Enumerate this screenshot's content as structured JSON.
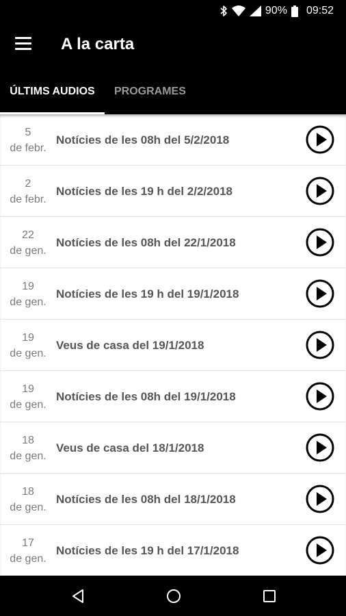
{
  "status_bar": {
    "battery": "90%",
    "time": "09:52"
  },
  "app_bar": {
    "title": "A la carta"
  },
  "tabs": [
    {
      "label": "ÚLTIMS AUDIOS",
      "active": true
    },
    {
      "label": "PROGRAMES",
      "active": false
    }
  ],
  "episodes": [
    {
      "day": "5",
      "month": "de febr.",
      "title": "Notícies de les 08h del 5/2/2018"
    },
    {
      "day": "2",
      "month": "de febr.",
      "title": "Notícies de les 19 h del 2/2/2018"
    },
    {
      "day": "22",
      "month": "de gen.",
      "title": "Notícies de les 08h del 22/1/2018"
    },
    {
      "day": "19",
      "month": "de gen.",
      "title": "Notícies de les 19 h del 19/1/2018"
    },
    {
      "day": "19",
      "month": "de gen.",
      "title": "Veus de casa del 19/1/2018"
    },
    {
      "day": "19",
      "month": "de gen.",
      "title": "Notícies de les 08h del 19/1/2018"
    },
    {
      "day": "18",
      "month": "de gen.",
      "title": "Veus de casa del 18/1/2018"
    },
    {
      "day": "18",
      "month": "de gen.",
      "title": "Notícies de les 08h del 18/1/2018"
    },
    {
      "day": "17",
      "month": "de gen.",
      "title": "Notícies de les 19 h del 17/1/2018"
    }
  ],
  "icons": {
    "menu": "hamburger-menu-icon",
    "play": "play-circle-icon",
    "nav_back": "triangle-back-icon",
    "nav_home": "circle-home-icon",
    "nav_recents": "square-recents-icon"
  }
}
